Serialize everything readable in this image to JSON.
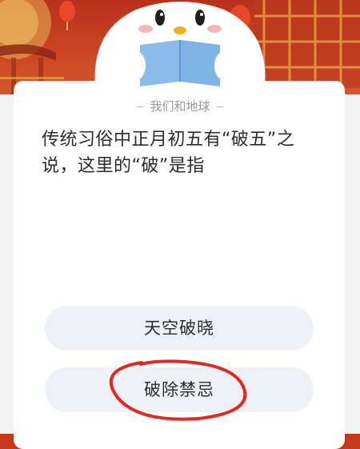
{
  "quiz": {
    "category": "我们和地球",
    "question": "传统习俗中正月初五有“破五”之说，这里的“破”是指",
    "options": [
      {
        "label": "天空破晓"
      },
      {
        "label": "破除禁忌"
      }
    ]
  },
  "colors": {
    "banner_red": "#c4391c",
    "card_white": "#ffffff",
    "option_bg": "#eef1f6",
    "annotation_red": "#e3281f",
    "book_blue": "#7fb4e7"
  },
  "icons": {
    "mascot": "penguin-reading-book-icon",
    "annotation": "hand-drawn-circle"
  }
}
